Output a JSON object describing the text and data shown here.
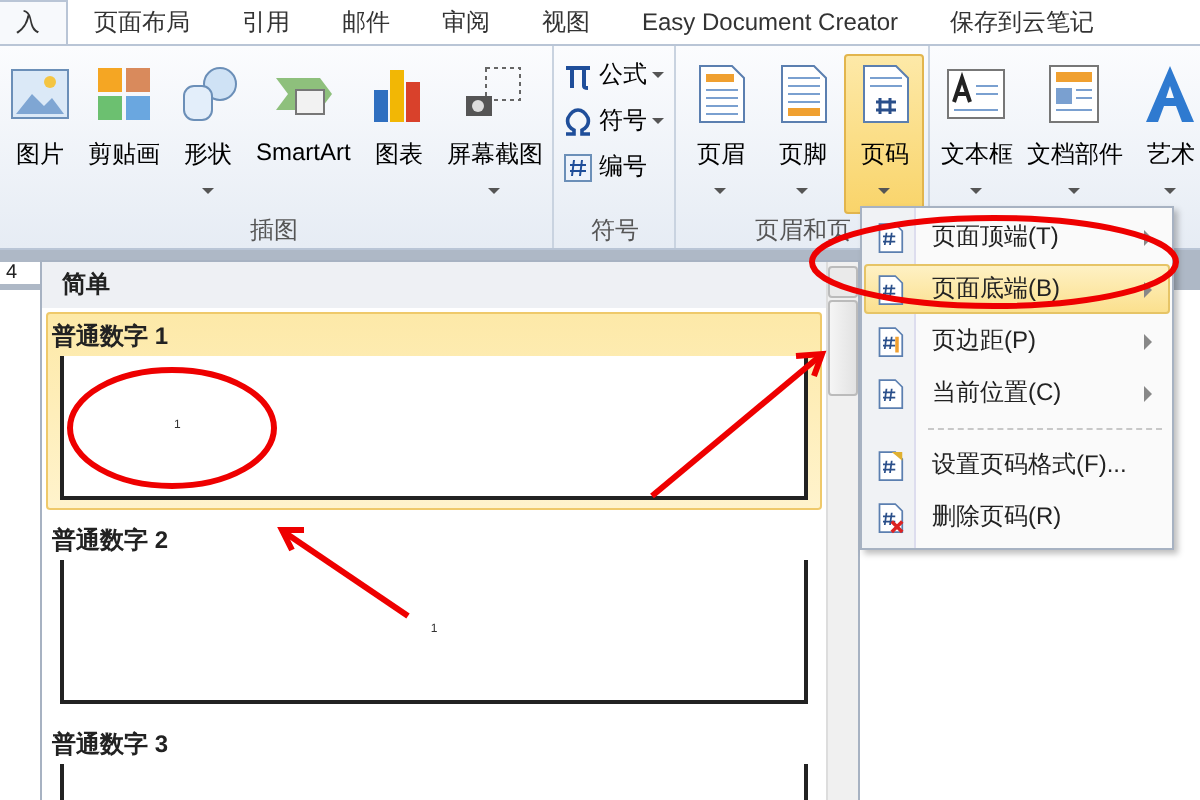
{
  "tabs": [
    {
      "label": "入",
      "selected": true
    },
    {
      "label": "页面布局",
      "selected": false
    },
    {
      "label": "引用",
      "selected": false
    },
    {
      "label": "邮件",
      "selected": false
    },
    {
      "label": "审阅",
      "selected": false
    },
    {
      "label": "视图",
      "selected": false
    },
    {
      "label": "Easy Document Creator",
      "selected": false
    },
    {
      "label": "保存到云笔记",
      "selected": false
    }
  ],
  "ribbon_groups": [
    {
      "label": "插图",
      "kind": "large",
      "buttons": [
        {
          "label": "图片",
          "dropdown": false,
          "selected": false
        },
        {
          "label": "剪贴画",
          "dropdown": false,
          "selected": false
        },
        {
          "label": "形状",
          "dropdown": true,
          "selected": false
        },
        {
          "label": "SmartArt",
          "dropdown": false,
          "selected": false
        },
        {
          "label": "图表",
          "dropdown": false,
          "selected": false
        },
        {
          "label": "屏幕截图",
          "dropdown": true,
          "selected": false
        }
      ]
    },
    {
      "label": "符号",
      "kind": "small",
      "buttons": [
        {
          "label": "公式",
          "dropdown": true,
          "selected": false
        },
        {
          "label": "符号",
          "dropdown": true,
          "selected": false
        },
        {
          "label": "编号",
          "dropdown": false,
          "selected": false
        }
      ]
    },
    {
      "label": "页眉和页",
      "kind": "large",
      "buttons": [
        {
          "label": "页眉",
          "dropdown": true,
          "selected": false
        },
        {
          "label": "页脚",
          "dropdown": true,
          "selected": false
        },
        {
          "label": "页码",
          "dropdown": true,
          "selected": true
        }
      ]
    },
    {
      "kind": "large",
      "buttons": [
        {
          "label": "文本框",
          "dropdown": true,
          "selected": false
        },
        {
          "label": "文档部件",
          "dropdown": true,
          "selected": false
        },
        {
          "label": "艺术",
          "dropdown": true,
          "selected": false
        }
      ]
    }
  ],
  "ruler": {
    "mark": "4"
  },
  "gallery": {
    "heading": "简单",
    "items": [
      {
        "label": "普通数字 1",
        "number": "1",
        "selected": true
      },
      {
        "label": "普通数字 2",
        "number": "1",
        "selected": false
      },
      {
        "label": "普通数字 3",
        "selected": false
      }
    ]
  },
  "menu": {
    "sections": [
      {
        "items": [
          {
            "label": "页面顶端(T)",
            "submenu": true,
            "selected": false
          },
          {
            "label": "页面底端(B)",
            "submenu": true,
            "selected": true
          },
          {
            "label": "页边距(P)",
            "submenu": true,
            "selected": false
          },
          {
            "label": "当前位置(C)",
            "submenu": true,
            "selected": false
          }
        ]
      },
      {
        "items": [
          {
            "label": "设置页码格式(F)...",
            "submenu": false,
            "selected": false
          },
          {
            "label": "删除页码(R)",
            "submenu": false,
            "selected": false
          }
        ]
      }
    ]
  }
}
